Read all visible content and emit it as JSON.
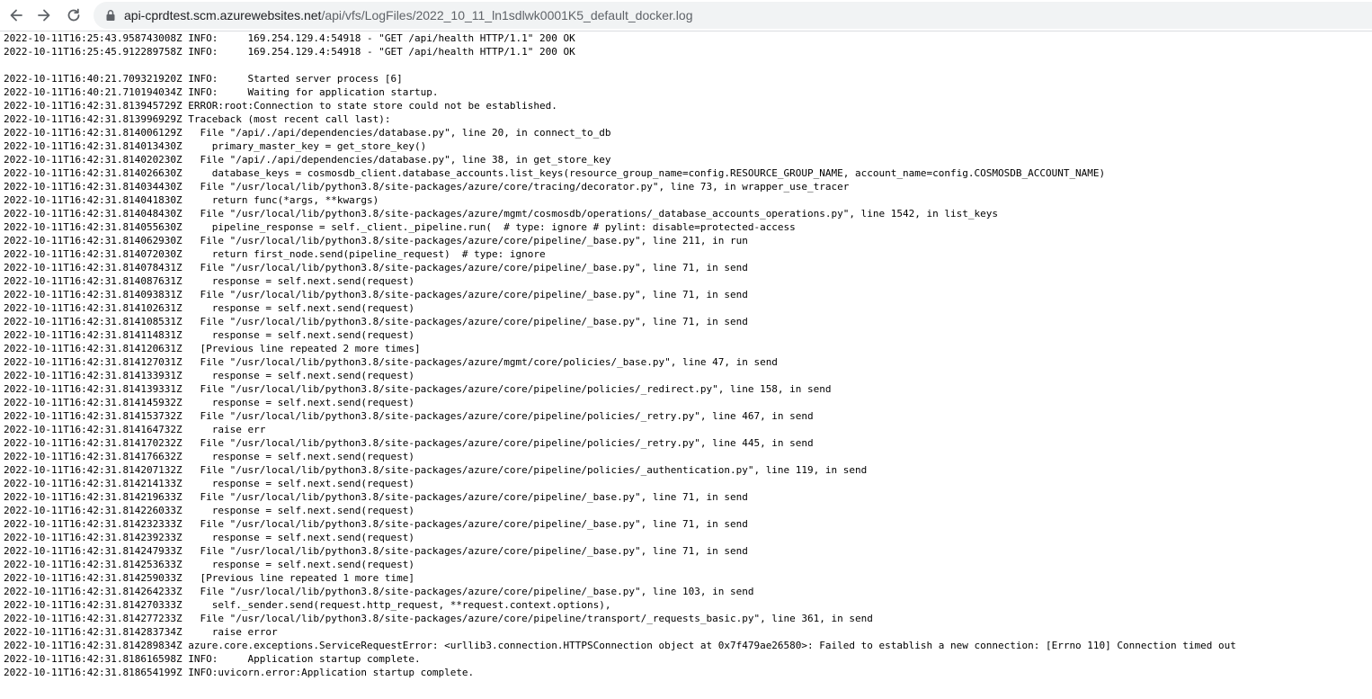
{
  "address_bar": {
    "host": "api-cprdtest.scm.azurewebsites.net",
    "path": "/api/vfs/LogFiles/2022_10_11_ln1sdlwk0001K5_default_docker.log"
  },
  "log_lines": [
    "2022-10-11T16:25:43.958743008Z INFO:     169.254.129.4:54918 - \"GET /api/health HTTP/1.1\" 200 OK",
    "2022-10-11T16:25:45.912289758Z INFO:     169.254.129.4:54918 - \"GET /api/health HTTP/1.1\" 200 OK",
    "",
    "2022-10-11T16:40:21.709321920Z INFO:     Started server process [6]",
    "2022-10-11T16:40:21.710194034Z INFO:     Waiting for application startup.",
    "2022-10-11T16:42:31.813945729Z ERROR:root:Connection to state store could not be established.",
    "2022-10-11T16:42:31.813996929Z Traceback (most recent call last):",
    "2022-10-11T16:42:31.814006129Z   File \"/api/./api/dependencies/database.py\", line 20, in connect_to_db",
    "2022-10-11T16:42:31.814013430Z     primary_master_key = get_store_key()",
    "2022-10-11T16:42:31.814020230Z   File \"/api/./api/dependencies/database.py\", line 38, in get_store_key",
    "2022-10-11T16:42:31.814026630Z     database_keys = cosmosdb_client.database_accounts.list_keys(resource_group_name=config.RESOURCE_GROUP_NAME, account_name=config.COSMOSDB_ACCOUNT_NAME)",
    "2022-10-11T16:42:31.814034430Z   File \"/usr/local/lib/python3.8/site-packages/azure/core/tracing/decorator.py\", line 73, in wrapper_use_tracer",
    "2022-10-11T16:42:31.814041830Z     return func(*args, **kwargs)",
    "2022-10-11T16:42:31.814048430Z   File \"/usr/local/lib/python3.8/site-packages/azure/mgmt/cosmosdb/operations/_database_accounts_operations.py\", line 1542, in list_keys",
    "2022-10-11T16:42:31.814055630Z     pipeline_response = self._client._pipeline.run(  # type: ignore # pylint: disable=protected-access",
    "2022-10-11T16:42:31.814062930Z   File \"/usr/local/lib/python3.8/site-packages/azure/core/pipeline/_base.py\", line 211, in run",
    "2022-10-11T16:42:31.814072030Z     return first_node.send(pipeline_request)  # type: ignore",
    "2022-10-11T16:42:31.814078431Z   File \"/usr/local/lib/python3.8/site-packages/azure/core/pipeline/_base.py\", line 71, in send",
    "2022-10-11T16:42:31.814087631Z     response = self.next.send(request)",
    "2022-10-11T16:42:31.814093831Z   File \"/usr/local/lib/python3.8/site-packages/azure/core/pipeline/_base.py\", line 71, in send",
    "2022-10-11T16:42:31.814102631Z     response = self.next.send(request)",
    "2022-10-11T16:42:31.814108531Z   File \"/usr/local/lib/python3.8/site-packages/azure/core/pipeline/_base.py\", line 71, in send",
    "2022-10-11T16:42:31.814114831Z     response = self.next.send(request)",
    "2022-10-11T16:42:31.814120631Z   [Previous line repeated 2 more times]",
    "2022-10-11T16:42:31.814127031Z   File \"/usr/local/lib/python3.8/site-packages/azure/mgmt/core/policies/_base.py\", line 47, in send",
    "2022-10-11T16:42:31.814133931Z     response = self.next.send(request)",
    "2022-10-11T16:42:31.814139331Z   File \"/usr/local/lib/python3.8/site-packages/azure/core/pipeline/policies/_redirect.py\", line 158, in send",
    "2022-10-11T16:42:31.814145932Z     response = self.next.send(request)",
    "2022-10-11T16:42:31.814153732Z   File \"/usr/local/lib/python3.8/site-packages/azure/core/pipeline/policies/_retry.py\", line 467, in send",
    "2022-10-11T16:42:31.814164732Z     raise err",
    "2022-10-11T16:42:31.814170232Z   File \"/usr/local/lib/python3.8/site-packages/azure/core/pipeline/policies/_retry.py\", line 445, in send",
    "2022-10-11T16:42:31.814176632Z     response = self.next.send(request)",
    "2022-10-11T16:42:31.814207132Z   File \"/usr/local/lib/python3.8/site-packages/azure/core/pipeline/policies/_authentication.py\", line 119, in send",
    "2022-10-11T16:42:31.814214133Z     response = self.next.send(request)",
    "2022-10-11T16:42:31.814219633Z   File \"/usr/local/lib/python3.8/site-packages/azure/core/pipeline/_base.py\", line 71, in send",
    "2022-10-11T16:42:31.814226033Z     response = self.next.send(request)",
    "2022-10-11T16:42:31.814232333Z   File \"/usr/local/lib/python3.8/site-packages/azure/core/pipeline/_base.py\", line 71, in send",
    "2022-10-11T16:42:31.814239233Z     response = self.next.send(request)",
    "2022-10-11T16:42:31.814247933Z   File \"/usr/local/lib/python3.8/site-packages/azure/core/pipeline/_base.py\", line 71, in send",
    "2022-10-11T16:42:31.814253633Z     response = self.next.send(request)",
    "2022-10-11T16:42:31.814259033Z   [Previous line repeated 1 more time]",
    "2022-10-11T16:42:31.814264233Z   File \"/usr/local/lib/python3.8/site-packages/azure/core/pipeline/_base.py\", line 103, in send",
    "2022-10-11T16:42:31.814270333Z     self._sender.send(request.http_request, **request.context.options),",
    "2022-10-11T16:42:31.814277233Z   File \"/usr/local/lib/python3.8/site-packages/azure/core/pipeline/transport/_requests_basic.py\", line 361, in send",
    "2022-10-11T16:42:31.814283734Z     raise error",
    "2022-10-11T16:42:31.814289834Z azure.core.exceptions.ServiceRequestError: <urllib3.connection.HTTPSConnection object at 0x7f479ae26580>: Failed to establish a new connection: [Errno 110] Connection timed out",
    "2022-10-11T16:42:31.818616598Z INFO:     Application startup complete.",
    "2022-10-11T16:42:31.818654199Z INFO:uvicorn.error:Application startup complete."
  ]
}
